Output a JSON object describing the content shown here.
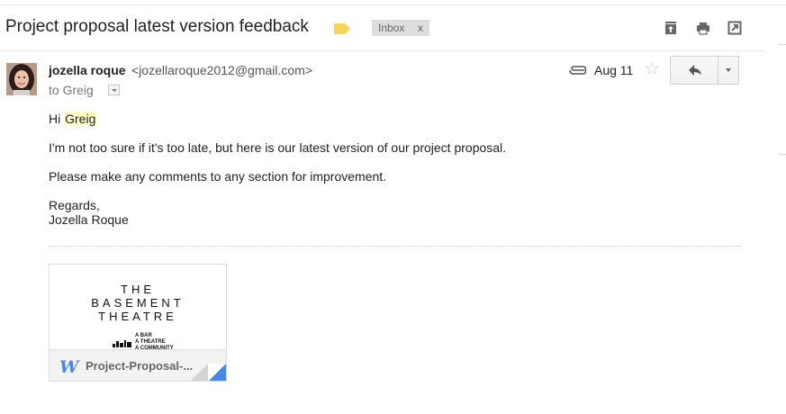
{
  "subject": "Project proposal latest version feedback",
  "labels": {
    "inbox": "Inbox",
    "remove": "x"
  },
  "toolbar": {
    "archive_icon": "archive-icon",
    "print_icon": "print-icon",
    "new_window_icon": "new-window-icon"
  },
  "message": {
    "sender_name": "jozella roque",
    "sender_email": "<jozellaroque2012@gmail.com>",
    "to_line": "to Greig",
    "date": "Aug 11",
    "star": "☆",
    "body": {
      "greeting_prefix": "Hi ",
      "greeting_name": "Greig",
      "line1": "I'm not too sure if it's too late, but here is our latest version of our project proposal.",
      "line2": "Please make any comments to any section for improvement.",
      "signoff": "Regards,",
      "signature": "Jozella Roque"
    }
  },
  "attachment": {
    "preview": {
      "line1": "THE",
      "line2": "BASEMENT",
      "line3": "THEATRE",
      "tagline": [
        "A BAR",
        "A THEATRE",
        "A COMMUNITY"
      ]
    },
    "filename": "Project-Proposal-...",
    "file_icon": "W"
  },
  "colors": {
    "label_yellow": "#f6d45c",
    "highlight": "#ffffc8",
    "doc_blue": "#4a86e8"
  }
}
